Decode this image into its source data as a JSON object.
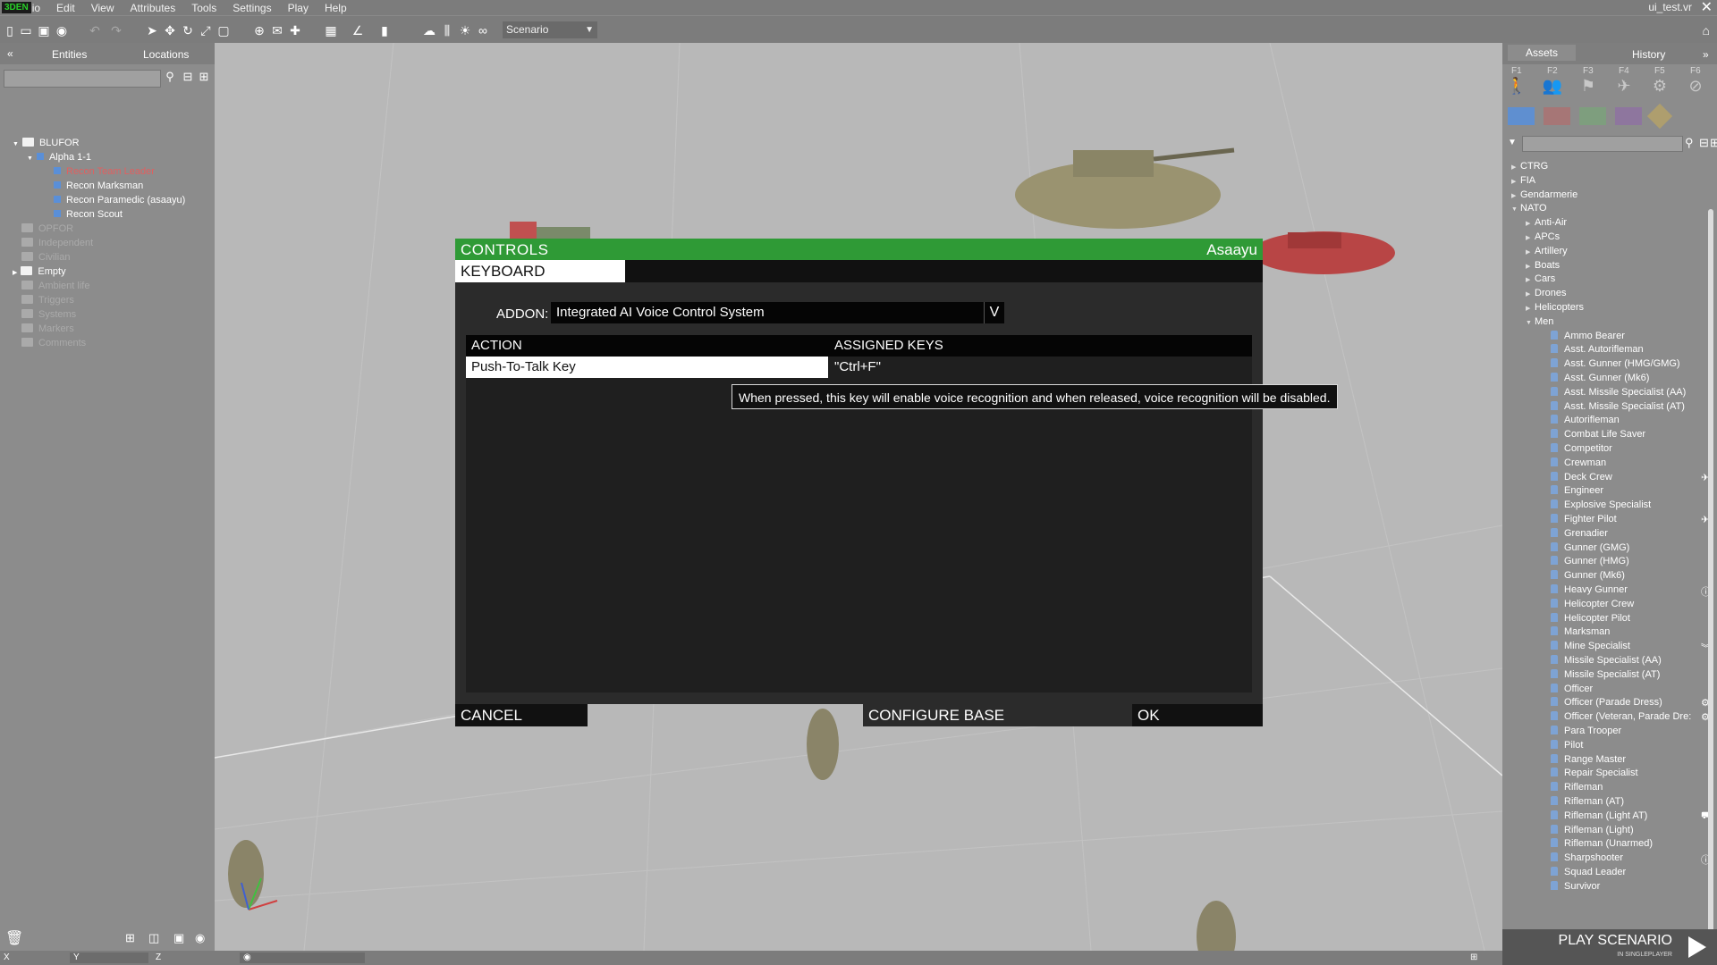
{
  "menubar": {
    "logo": "3DEN",
    "items": [
      "io",
      "Edit",
      "View",
      "Attributes",
      "Tools",
      "Settings",
      "Play",
      "Help"
    ],
    "mission_name": "ui_test.vr"
  },
  "toolbar": {
    "scenario_label": "Scenario",
    "icons": [
      "new-file-icon",
      "open-file-icon",
      "save-icon",
      "publish-icon",
      "undo-icon",
      "redo-icon",
      "select-icon",
      "translate-icon",
      "rotate-icon",
      "scale-icon",
      "area-icon",
      "globe-icon",
      "map-icon",
      "vertical-icon",
      "grid-icon",
      "angle-icon",
      "terrain-snap-icon",
      "weather-icon",
      "environment-icon",
      "lighting-icon",
      "vision-icon"
    ]
  },
  "left_panel": {
    "tabs": [
      "Entities",
      "Locations"
    ],
    "tree": {
      "blufor": "BLUFOR",
      "group": "Alpha 1-1",
      "units": [
        "Recon Team Leader",
        "Recon Marksman",
        "Recon Paramedic (asaayu)",
        "Recon Scout"
      ],
      "other_folders": [
        "OPFOR",
        "Independent",
        "Civilian"
      ],
      "empty": "Empty",
      "dim_folders": [
        "Ambient life",
        "Triggers",
        "Systems",
        "Markers",
        "Comments"
      ]
    }
  },
  "right_panel": {
    "tabs": [
      "Assets",
      "History"
    ],
    "fkeys": [
      "F1",
      "F2",
      "F3",
      "F4",
      "F5",
      "F6"
    ],
    "swatch_colors": [
      "#5f8fd0",
      "#c06060",
      "#70b070",
      "#9060b0",
      "#d0b050"
    ],
    "factions": [
      "CTRG",
      "FIA",
      "Gendarmerie",
      "NATO"
    ],
    "categories": [
      "Anti-Air",
      "APCs",
      "Artillery",
      "Boats",
      "Cars",
      "Drones",
      "Helicopters",
      "Men"
    ],
    "men": [
      "Ammo Bearer",
      "Asst. Autorifleman",
      "Asst. Gunner (HMG/GMG)",
      "Asst. Gunner (Mk6)",
      "Asst. Missile Specialist (AA)",
      "Asst. Missile Specialist (AT)",
      "Autorifleman",
      "Combat Life Saver",
      "Competitor",
      "Crewman",
      "Deck Crew",
      "Engineer",
      "Explosive Specialist",
      "Fighter Pilot",
      "Grenadier",
      "Gunner (GMG)",
      "Gunner (HMG)",
      "Gunner (Mk6)",
      "Heavy Gunner",
      "Helicopter Crew",
      "Helicopter Pilot",
      "Marksman",
      "Mine Specialist",
      "Missile Specialist (AA)",
      "Missile Specialist (AT)",
      "Officer",
      "Officer (Parade Dress)",
      "Officer (Veteran, Parade Dre:",
      "Para Trooper",
      "Pilot",
      "Range Master",
      "Repair Specialist",
      "Rifleman",
      "Rifleman (AT)",
      "Rifleman (Light AT)",
      "Rifleman (Light)",
      "Rifleman (Unarmed)",
      "Sharpshooter",
      "Squad Leader",
      "Survivor"
    ],
    "play_label": "PLAY SCENARIO",
    "play_sub": "IN SINGLEPLAYER"
  },
  "statusbar": {
    "fields": [
      "X",
      "Y",
      "Z"
    ]
  },
  "dialog": {
    "title": "CONTROLS",
    "user": "Asaayu",
    "tab": "KEYBOARD",
    "addon_label": "ADDON:",
    "addon_value": "Integrated AI Voice Control System",
    "addon_arrow": "V",
    "table": {
      "col_action": "ACTION",
      "col_keys": "ASSIGNED KEYS",
      "rows": [
        {
          "action": "Push-To-Talk Key",
          "keys": "\"Ctrl+F\""
        }
      ]
    },
    "tooltip": "When pressed, this key will enable voice recognition and when released, voice recognition will be disabled.",
    "buttons": {
      "cancel": "CANCEL",
      "configure": "CONFIGURE BASE",
      "ok": "OK"
    }
  }
}
